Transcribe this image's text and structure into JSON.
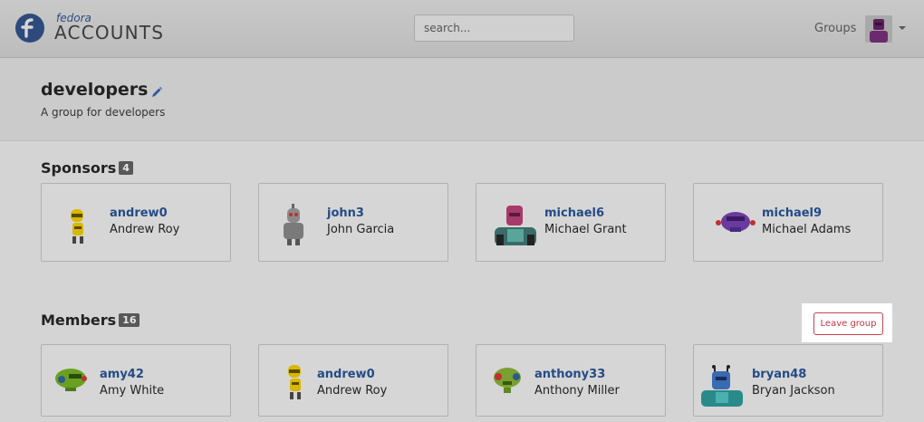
{
  "navbar": {
    "brand_small": "fedora",
    "brand_big": "ACCOUNTS",
    "search_placeholder": "search...",
    "groups_link": "Groups"
  },
  "group": {
    "name": "developers",
    "description": "A group for developers"
  },
  "sponsors": {
    "title": "Sponsors",
    "count": "4",
    "items": [
      {
        "username": "andrew0",
        "fullname": "Andrew Roy",
        "avatar": "yellow-robot"
      },
      {
        "username": "john3",
        "fullname": "John Garcia",
        "avatar": "grey-robot"
      },
      {
        "username": "michael6",
        "fullname": "Michael Grant",
        "avatar": "pink-robot"
      },
      {
        "username": "michael9",
        "fullname": "Michael Adams",
        "avatar": "purple-robot"
      }
    ]
  },
  "members": {
    "title": "Members",
    "count": "16",
    "leave_label": "Leave group",
    "items": [
      {
        "username": "amy42",
        "fullname": "Amy White",
        "avatar": "green-robot"
      },
      {
        "username": "andrew0",
        "fullname": "Andrew Roy",
        "avatar": "yellow-robot"
      },
      {
        "username": "anthony33",
        "fullname": "Anthony Miller",
        "avatar": "green-robot-2"
      },
      {
        "username": "bryan48",
        "fullname": "Bryan Jackson",
        "avatar": "blue-robot"
      }
    ]
  },
  "colors": {
    "link": "#244b86",
    "danger": "#c13843",
    "badge": "#585858"
  }
}
